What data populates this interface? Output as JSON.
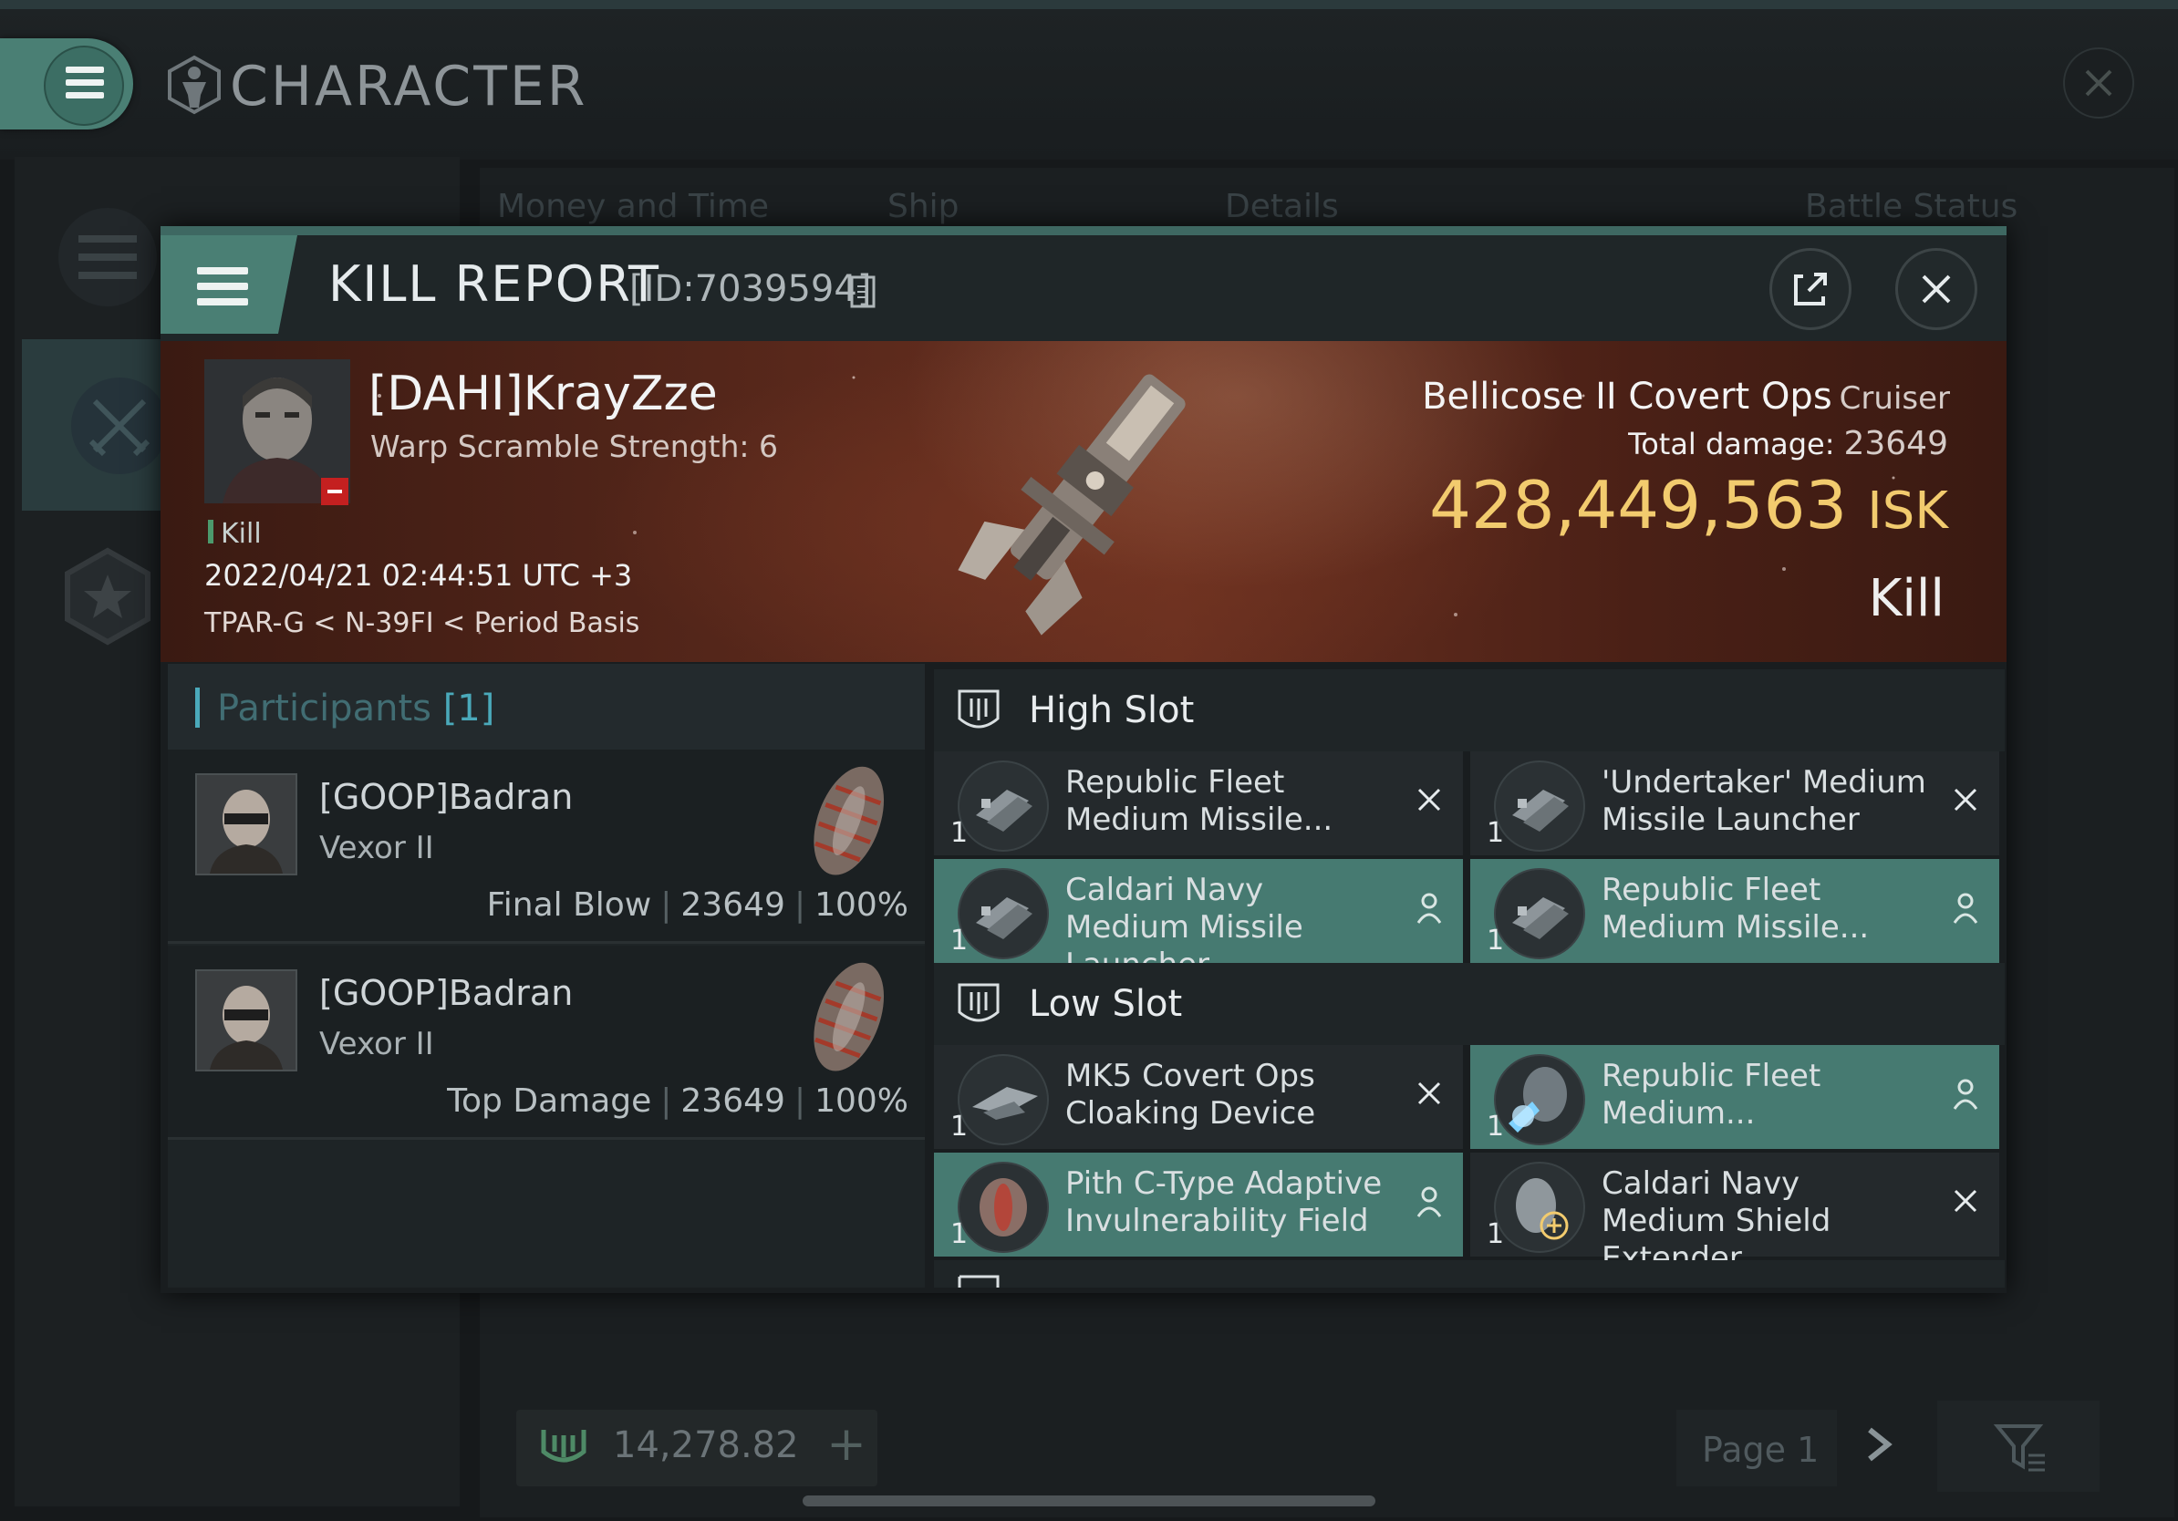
{
  "app": {
    "title": "CHARACTER",
    "tabs": [
      "Money and Time",
      "Ship",
      "Details",
      "Battle Status"
    ],
    "wallet": "14,278.82",
    "page_label": "Page 1"
  },
  "kill_report": {
    "title": "KILL REPORT",
    "id_label": "[ID:7039594]",
    "victim": {
      "name": "[DAHI]KrayZze",
      "warp_scramble": "Warp Scramble Strength: 6",
      "tag": "Kill",
      "time": "2022/04/21 02:44:51 UTC +3",
      "location": "TPAR-G < N-39FI < Period Basis"
    },
    "ship": {
      "name": "Bellicose II Covert Ops",
      "class": "Cruiser",
      "damage_label": "Total damage:",
      "damage_value": "23649",
      "isk_value": "428,449,563",
      "isk_unit": "ISK",
      "result": "Kill"
    },
    "participants": {
      "title": "Participants",
      "count": "[1]",
      "rows": [
        {
          "name": "[GOOP]Badran",
          "ship": "Vexor II",
          "label": "Final Blow",
          "damage": "23649",
          "percent": "100%"
        },
        {
          "name": "[GOOP]Badran",
          "ship": "Vexor II",
          "label": "Top Damage",
          "damage": "23649",
          "percent": "100%"
        }
      ]
    },
    "fitting": {
      "high_slot": {
        "title": "High Slot",
        "modules": [
          {
            "name": "Republic Fleet Medium Missile...",
            "qty": "1",
            "status": "destroyed"
          },
          {
            "name": "'Undertaker' Medium Missile Launcher",
            "qty": "1",
            "status": "destroyed"
          },
          {
            "name": "Caldari Navy Medium Missile Launcher",
            "qty": "1",
            "status": "dropped"
          },
          {
            "name": "Republic Fleet Medium Missile...",
            "qty": "1",
            "status": "dropped"
          }
        ]
      },
      "low_slot": {
        "title": "Low Slot",
        "modules": [
          {
            "name": "MK5 Covert Ops Cloaking Device",
            "qty": "1",
            "status": "destroyed"
          },
          {
            "name": "Republic Fleet Medium...",
            "qty": "1",
            "status": "dropped"
          },
          {
            "name": "Pith C-Type Adaptive Invulnerability Field",
            "qty": "1",
            "status": "dropped"
          },
          {
            "name": "Caldari Navy Medium Shield Extender",
            "qty": "1",
            "status": "destroyed"
          }
        ]
      }
    }
  },
  "colors": {
    "accent": "#4a7f74",
    "dropped_row": "#467a71",
    "isk_gold": "#f2cb6e",
    "banner_red": "#6a3020"
  }
}
